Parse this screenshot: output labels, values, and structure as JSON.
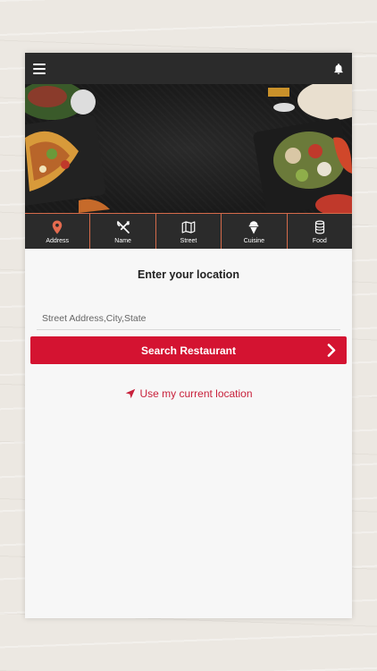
{
  "topbar": {
    "menu_icon": "hamburger-menu-icon",
    "bell_icon": "bell-icon"
  },
  "tabs": [
    {
      "label": "Address",
      "icon": "map-pin-icon"
    },
    {
      "label": "Name",
      "icon": "fork-knife-icon"
    },
    {
      "label": "Street",
      "icon": "map-icon"
    },
    {
      "label": "Cuisine",
      "icon": "ice-cream-icon"
    },
    {
      "label": "Food",
      "icon": "can-icon"
    }
  ],
  "main": {
    "heading": "Enter your location",
    "address_placeholder": "Street Address,City,State",
    "search_button": "Search Restaurant",
    "current_location_link": "Use my current location"
  },
  "colors": {
    "accent": "#d41331",
    "link": "#c8213b",
    "topbar": "#2b2b2b",
    "pin": "#e46b4f"
  }
}
